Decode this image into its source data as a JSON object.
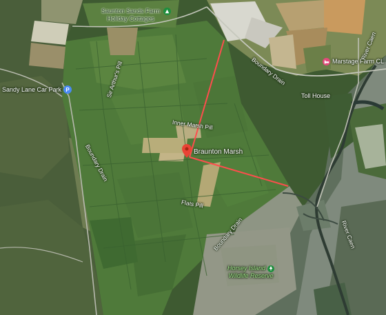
{
  "map": {
    "places": [
      {
        "key": "saunton",
        "line1": "Saunton Sands Farm",
        "line2": "Holiday Cottages"
      },
      {
        "key": "marstage",
        "label": "Marstage Farm CL"
      },
      {
        "key": "sandy",
        "label": "Sandy Lane Car Park"
      },
      {
        "key": "tollhouse",
        "label": "Toll House"
      },
      {
        "key": "horsey",
        "line1": "Horsey Island",
        "line2": "Wildlife Reserve"
      }
    ],
    "selected_pin": {
      "label": "Braunton Marsh"
    },
    "waterways": [
      "Inner Marsh Pill",
      "Sir Arthur's Pill",
      "Boundary Drain",
      "Flats Pill",
      "Boundary Drain",
      "Boundary Drain",
      "River Caen",
      "River Caen"
    ],
    "colors": {
      "route": "#ff4d4d",
      "pin": "#ea4335",
      "campsite_icon": "#1e8e3e",
      "parking_icon": "#4a8af4",
      "farm_icon": "#e24a7a"
    },
    "icons": {
      "saunton": "campsite-icon",
      "marstage": "bed-icon",
      "sandy": "parking-icon",
      "horsey": "park-icon"
    }
  }
}
